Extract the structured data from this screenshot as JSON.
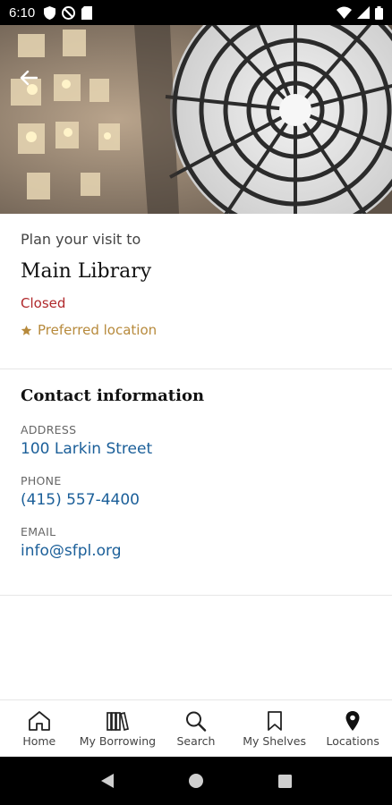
{
  "status_bar": {
    "time": "6:10"
  },
  "header": {
    "back_icon": "arrow-left-icon"
  },
  "visit": {
    "plan_label": "Plan your visit to",
    "library_name": "Main Library",
    "status": "Closed",
    "preferred": "Preferred location"
  },
  "contact": {
    "title": "Contact information",
    "address_label": "ADDRESS",
    "address": "100 Larkin Street",
    "phone_label": "PHONE",
    "phone": "(415) 557-4400",
    "email_label": "EMAIL",
    "email": "info@sfpl.org"
  },
  "nav": {
    "items": [
      {
        "label": "Home",
        "icon": "home-icon"
      },
      {
        "label": "My Borrowing",
        "icon": "books-icon"
      },
      {
        "label": "Search",
        "icon": "search-icon"
      },
      {
        "label": "My Shelves",
        "icon": "bookmark-icon"
      },
      {
        "label": "Locations",
        "icon": "map-pin-icon"
      }
    ]
  },
  "colors": {
    "closed": "#b0282b",
    "preferred": "#b78a3c",
    "link": "#1b5f99"
  }
}
